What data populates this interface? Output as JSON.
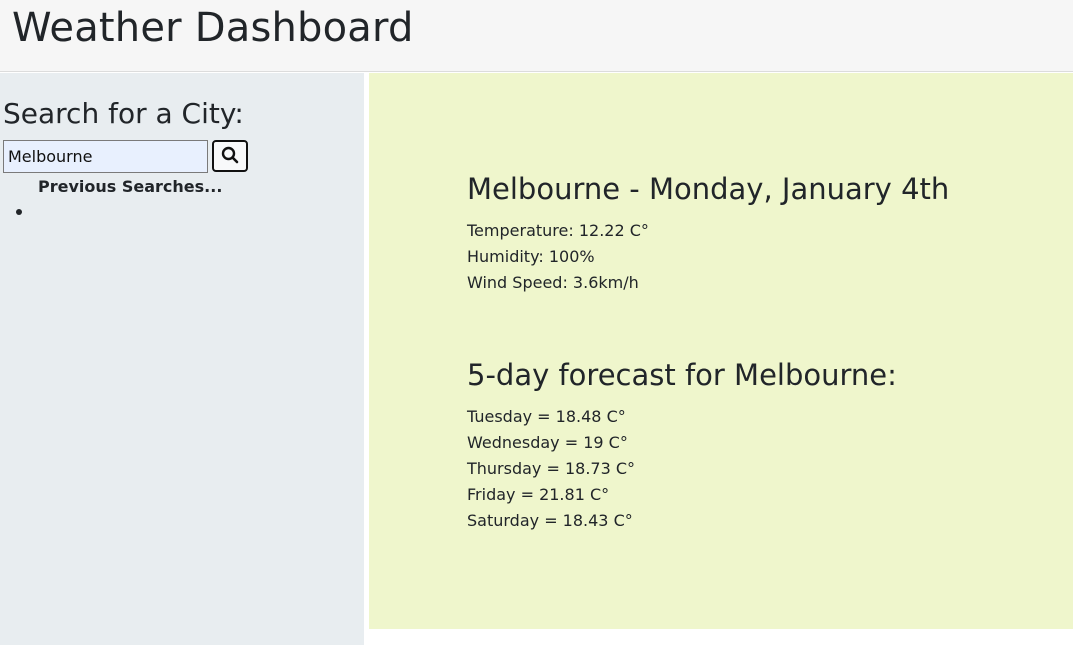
{
  "header": {
    "title": "Weather Dashboard"
  },
  "sidebar": {
    "heading": "Search for a City:",
    "search": {
      "value": "Melbourne",
      "button_icon": "search-icon"
    },
    "previous_searches_title": "Previous Searches...",
    "previous_searches": [
      ""
    ]
  },
  "today": {
    "title": "Melbourne - Monday, January 4th",
    "temperature": "Temperature: 12.22 C°",
    "humidity": "Humidity: 100%",
    "wind_speed": "Wind Speed: 3.6km/h"
  },
  "forecast": {
    "title": "5-day forecast for Melbourne:",
    "days": [
      "Tuesday = 18.48 C°",
      "Wednesday = 19 C°",
      "Thursday = 18.73 C°",
      "Friday = 21.81 C°",
      "Saturday = 18.43 C°"
    ]
  },
  "colors": {
    "sidebar_bg": "#e8edf0",
    "main_bg": "#eff6cc",
    "header_bg": "#f6f6f6",
    "input_bg": "#e8f0fe"
  }
}
